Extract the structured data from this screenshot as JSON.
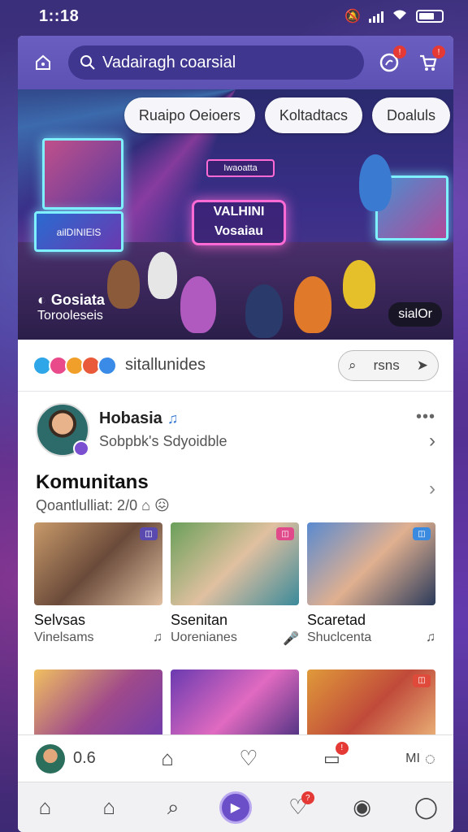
{
  "status_bar": {
    "time": "1::18"
  },
  "search": {
    "placeholder": "Vadairagh coarsial"
  },
  "header": {
    "notif_badge": "!",
    "cart_badge": "!"
  },
  "hero": {
    "chips": [
      "Ruaipo Oeioers",
      "Koltadtacs",
      "Doaluls"
    ],
    "neon_sign": "VALHINI Vosaiau",
    "top_sign": "Iwaoatta",
    "screen_label": "ailDINIElS",
    "caption_title": "Gosiata",
    "caption_sub": "Torooleseis",
    "tag": "sialOr"
  },
  "stories": {
    "label": "sitallunides",
    "search_label": "rsns"
  },
  "profile": {
    "name": "Hobasia",
    "subtitle": "Sobpbk's Sdyoidble"
  },
  "section": {
    "title": "Komunitans",
    "subtitle": "Qoantlulliat: 2/0"
  },
  "tiles": [
    {
      "title": "Selvsas",
      "sub": "Vinelsams"
    },
    {
      "title": "Ssenitan",
      "sub": "Uorenianes"
    },
    {
      "title": "Scaretad",
      "sub": "Shuclcenta"
    }
  ],
  "mini_player": {
    "count": "0.6",
    "right_label": "MI"
  },
  "bottom_nav": {
    "badge": "?"
  }
}
